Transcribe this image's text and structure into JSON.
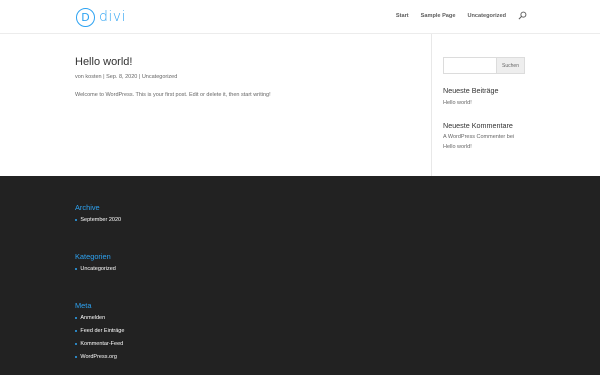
{
  "header": {
    "logo_mark": "D",
    "logo_text": "divi",
    "nav": [
      "Start",
      "Sample Page",
      "Uncategorized"
    ],
    "accent": "#2ea3f2"
  },
  "post": {
    "title": "Hello world!",
    "meta": {
      "author_prefix": "von ",
      "author": "kosten",
      "sep1": " | ",
      "date": "Sep. 8, 2020",
      "sep2": " | ",
      "category": "Uncategorized"
    },
    "body": "Welcome to WordPress. This is your first post. Edit or delete it, then start writing!"
  },
  "sidebar": {
    "search_placeholder": "",
    "search_button": "Suchen",
    "recent_posts_heading": "Neueste Beiträge",
    "recent_posts": [
      "Hello world!"
    ],
    "recent_comments_heading": "Neueste Kommentare",
    "recent_comment_author": "A WordPress Commenter",
    "recent_comment_mid": " bei",
    "recent_comment_post": "Hello world!"
  },
  "footer": {
    "archive_heading": "Archive",
    "archive_items": [
      "September 2020"
    ],
    "categories_heading": "Kategorien",
    "categories_items": [
      "Uncategorized"
    ],
    "meta_heading": "Meta",
    "meta_items": [
      "Anmelden",
      "Feed der Einträge",
      "Kommentar-Feed",
      "WordPress.org"
    ],
    "bg": "#222222"
  },
  "icons": {
    "search": "search-icon",
    "bullet": "bullet-icon"
  }
}
